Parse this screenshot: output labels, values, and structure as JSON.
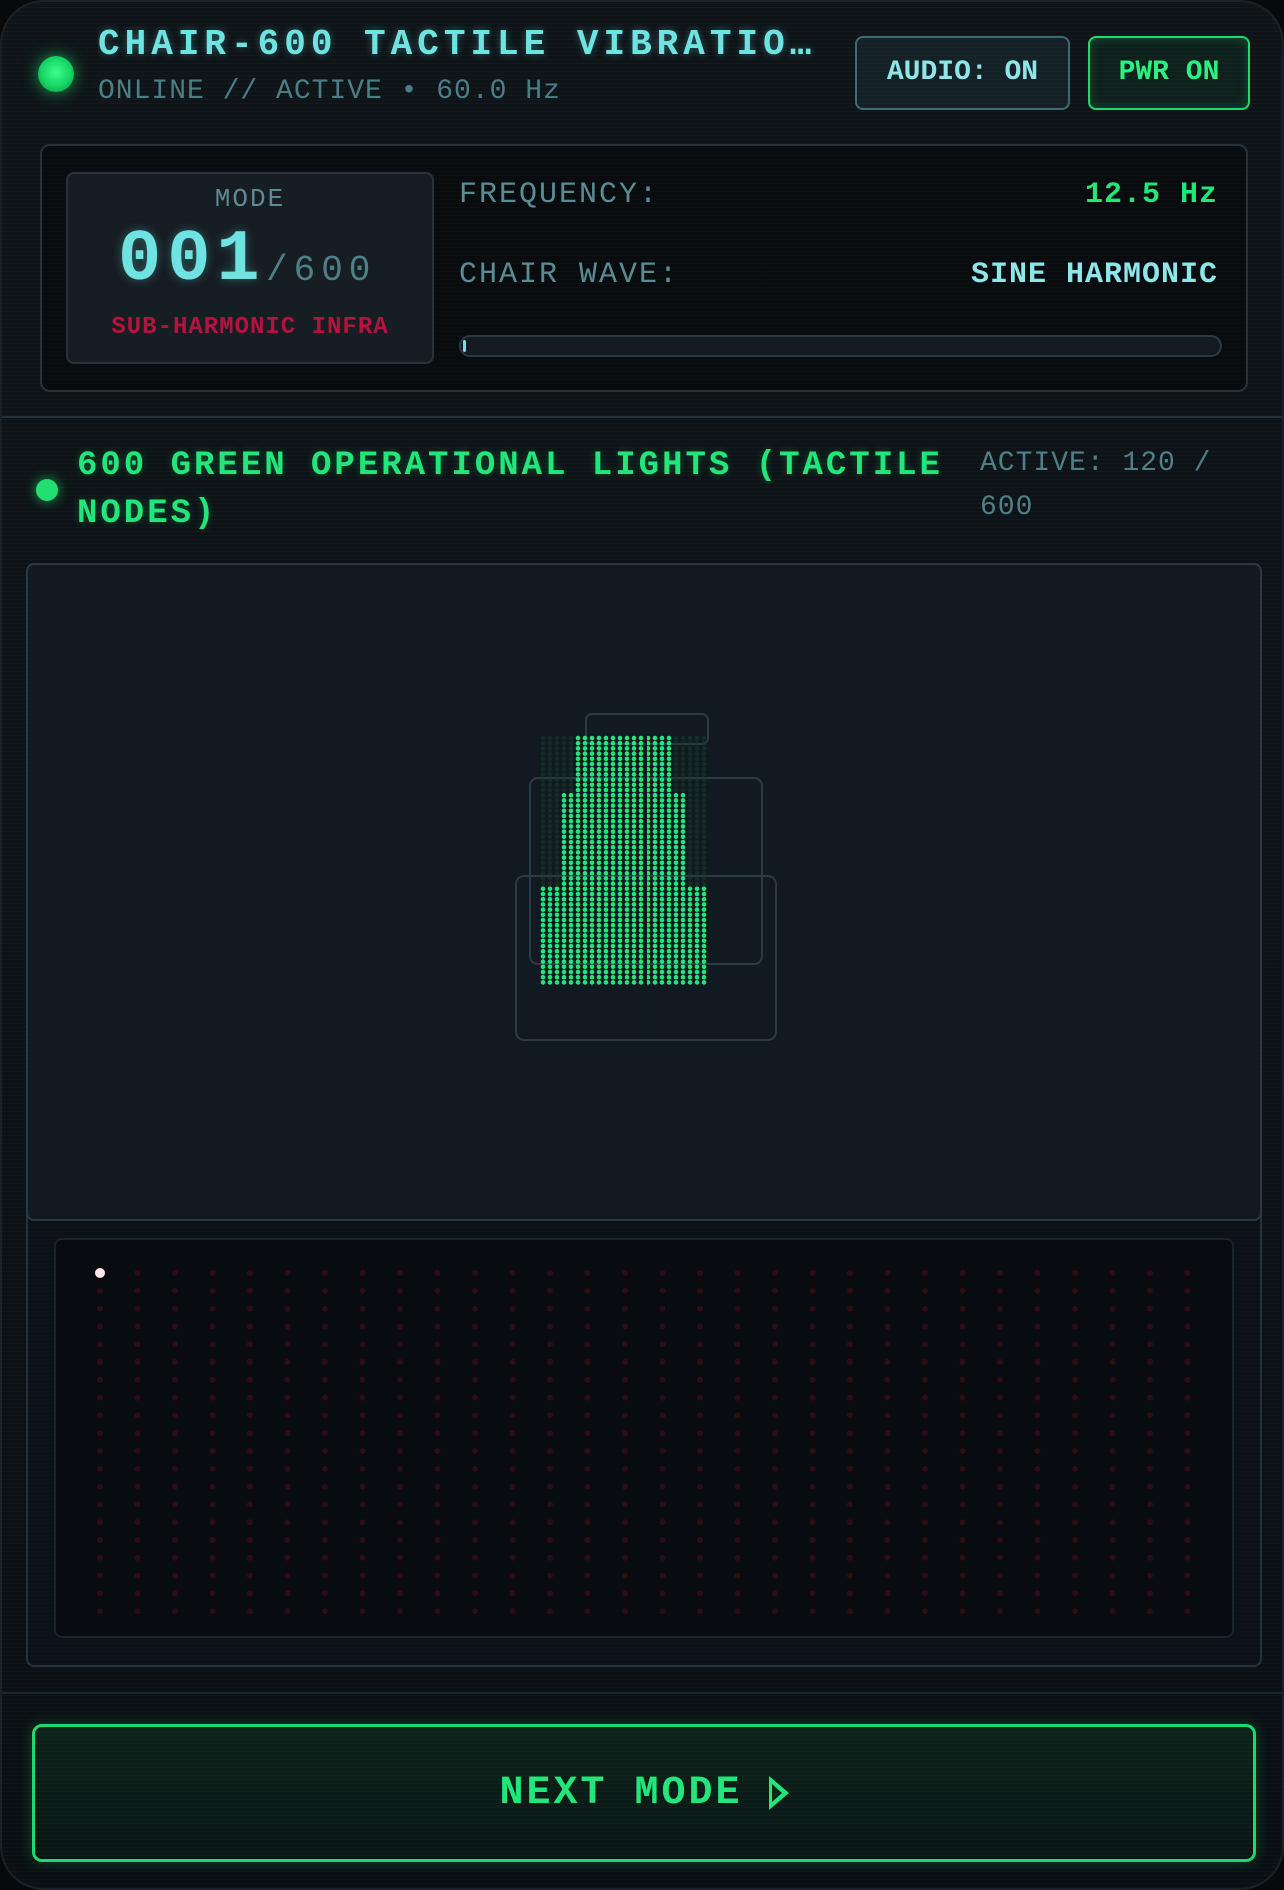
{
  "header": {
    "title": "CHAIR-600 TACTILE VIBRATION …",
    "status": "ONLINE // ACTIVE • 60.0 Hz",
    "audio_label": "AUDIO: ON",
    "power_label": "PWR ON"
  },
  "mode": {
    "label": "MODE",
    "current": "001",
    "total": "/600",
    "name": "SUB-HARMONIC INFRA"
  },
  "readouts": {
    "frequency_label": "FREQUENCY:",
    "frequency_value": "12.5 Hz",
    "wave_label": "CHAIR WAVE:",
    "wave_value": "SINE HARMONIC",
    "progress": 0.003
  },
  "nodes": {
    "title": "600 GREEN OPERATIONAL LIGHTS (TACTILE NODES)",
    "count_text": "ACTIVE: 120 / 600",
    "active": 120,
    "total": 600
  },
  "controls": {
    "next_label": "NEXT MODE",
    "next_icon": "play-triangle-icon"
  },
  "colors": {
    "accent_green": "#22e67a",
    "accent_cyan": "#6fe3e2",
    "alert_red": "#b3143e"
  }
}
